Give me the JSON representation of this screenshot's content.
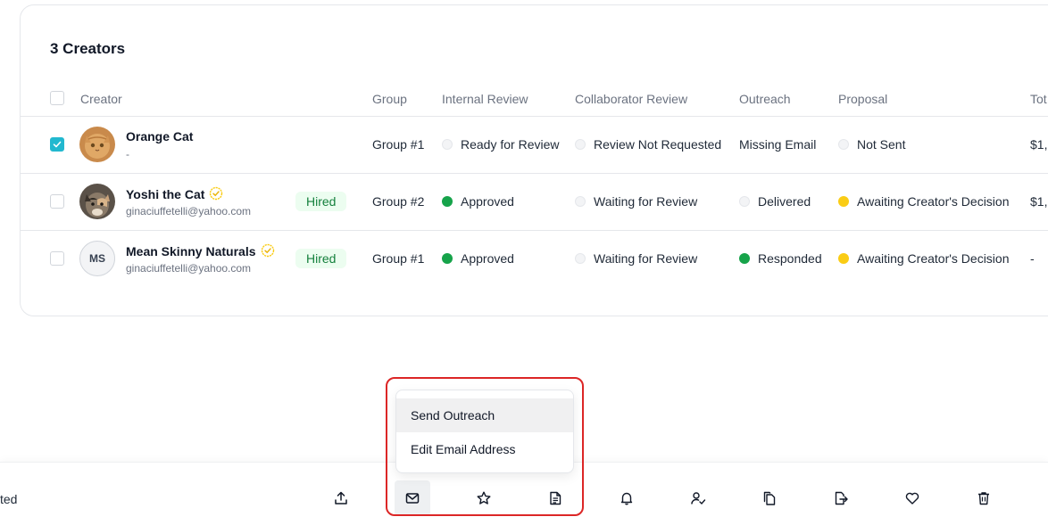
{
  "table": {
    "title": "3 Creators",
    "headers": {
      "creator": "Creator",
      "group": "Group",
      "internal_review": "Internal Review",
      "collaborator_review": "Collaborator Review",
      "outreach": "Outreach",
      "proposal": "Proposal",
      "total": "Tot"
    },
    "rows": [
      {
        "checked": true,
        "name": "Orange Cat",
        "sub": "-",
        "avatar": "cat-photo",
        "badge": "",
        "group": "Group #1",
        "internal_review": "Ready for Review",
        "internal_status": "grey",
        "collaborator_review": "Review Not Requested",
        "collaborator_status": "grey",
        "outreach": "Missing Email",
        "outreach_status": "none",
        "proposal": "Not Sent",
        "proposal_status": "grey",
        "total": "$1,"
      },
      {
        "checked": false,
        "name": "Yoshi the Cat",
        "sub": "ginaciuffetelli@yahoo.com",
        "avatar": "cat-photo",
        "verified": true,
        "badge": "Hired",
        "group": "Group #2",
        "internal_review": "Approved",
        "internal_status": "green",
        "collaborator_review": "Waiting for Review",
        "collaborator_status": "grey",
        "outreach": "Delivered",
        "outreach_status": "grey",
        "proposal": "Awaiting Creator's Decision",
        "proposal_status": "yellow",
        "total": "$1,"
      },
      {
        "checked": false,
        "name": "Mean Skinny Naturals",
        "sub": "ginaciuffetelli@yahoo.com",
        "avatar_initials": "MS",
        "verified": true,
        "badge": "Hired",
        "group": "Group #1",
        "internal_review": "Approved",
        "internal_status": "green",
        "collaborator_review": "Waiting for Review",
        "collaborator_status": "grey",
        "outreach": "Responded",
        "outreach_status": "green",
        "proposal": "Awaiting Creator's Decision",
        "proposal_status": "yellow",
        "total": "-"
      }
    ]
  },
  "bottom_bar": {
    "selected_text": "ted",
    "tools": [
      "export-icon",
      "mail-icon",
      "star-icon",
      "document-icon",
      "bell-icon",
      "user-check-icon",
      "copy-icon",
      "file-export-icon",
      "heart-icon",
      "trash-icon"
    ],
    "active_tool": "mail-icon"
  },
  "dropdown": {
    "items": [
      "Send Outreach",
      "Edit Email Address"
    ],
    "highlighted": "Send Outreach"
  },
  "colors": {
    "accent": "#22b8cf",
    "approved": "#16a34a",
    "awaiting": "#facc15",
    "hired_bg": "#ecfdf0",
    "annotation": "#dc2626"
  }
}
